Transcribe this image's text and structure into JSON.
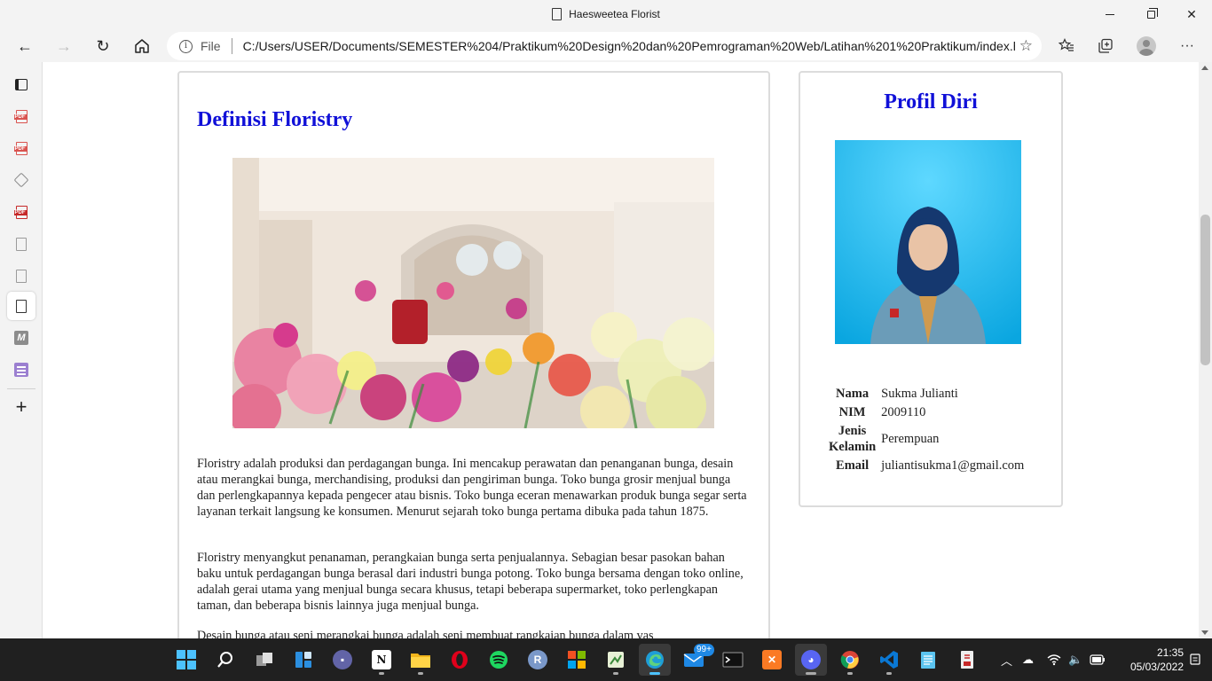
{
  "window": {
    "title": "Haesweetea Florist"
  },
  "navbar": {
    "scheme_label": "File",
    "url": "C:/Users/USER/Documents/SEMESTER%204/Praktikum%20Design%20dan%20Pemrograman%20Web/Latihan%201%20Praktikum/index.h..."
  },
  "sidebar": {
    "tabs": [
      {
        "icon": "tab-actions-icon"
      },
      {
        "icon": "pdf-icon"
      },
      {
        "icon": "pdf-icon"
      },
      {
        "icon": "codepen-icon"
      },
      {
        "icon": "pdf-icon"
      },
      {
        "icon": "page-icon"
      },
      {
        "icon": "page-icon"
      },
      {
        "icon": "page-icon",
        "active": true
      },
      {
        "icon": "m-icon"
      },
      {
        "icon": "list-icon"
      }
    ]
  },
  "article": {
    "title": "Definisi Floristry",
    "paragraphs": [
      "Floristry adalah produksi dan perdagangan bunga. Ini mencakup perawatan dan penanganan bunga, desain atau merangkai bunga, merchandising, produksi dan pengiriman bunga. Toko bunga grosir menjual bunga dan perlengkapannya kepada pengecer atau bisnis. Toko bunga eceran menawarkan produk bunga segar serta layanan terkait langsung ke konsumen. Menurut sejarah toko bunga pertama dibuka pada tahun 1875.",
      "Floristry menyangkut penanaman, perangkaian bunga serta penjualannya. Sebagian besar pasokan bahan baku untuk perdagangan bunga berasal dari industri bunga potong. Toko bunga bersama dengan toko online, adalah gerai utama yang menjual bunga secara khusus, tetapi beberapa supermarket, toko perlengkapan taman, dan beberapa bisnis lainnya juga menjual bunga.",
      "Desain bunga atau seni merangkai bunga adalah seni membuat rangkaian bunga dalam vas"
    ]
  },
  "profile": {
    "title": "Profil Diri",
    "rows": [
      {
        "label": "Nama",
        "value": "Sukma Julianti"
      },
      {
        "label": "NIM",
        "value": "2009110"
      },
      {
        "label": "Jenis Kelamin",
        "value": "Perempuan"
      },
      {
        "label": "Email",
        "value": "juliantisukma1@gmail.com"
      }
    ]
  },
  "taskbar": {
    "mail_badge": "99+",
    "time": "21:35",
    "date": "05/03/2022"
  },
  "colors": {
    "heading": "#1010d8",
    "taskbar_bg": "#202020",
    "accent": "#4cc2ff"
  }
}
